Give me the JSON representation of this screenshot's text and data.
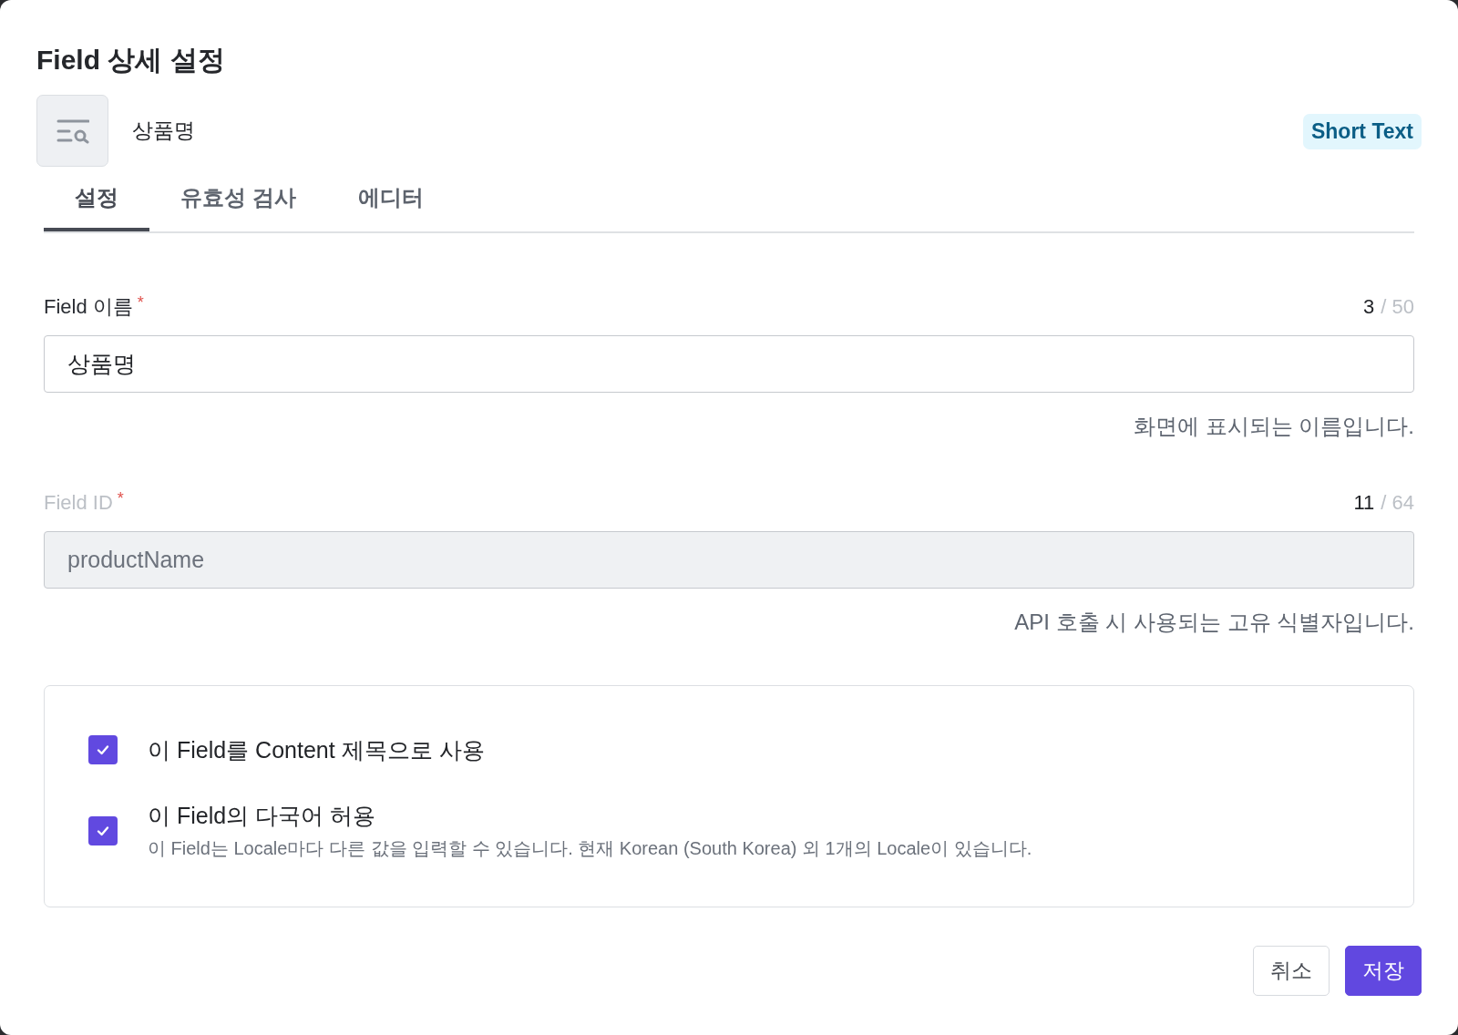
{
  "dialog": {
    "title": "Field 상세 설정"
  },
  "field_header": {
    "name": "상품명",
    "type_badge": "Short Text"
  },
  "tabs": [
    {
      "label": "설정",
      "selected": true
    },
    {
      "label": "유효성 검사",
      "selected": false
    },
    {
      "label": "에디터",
      "selected": false
    }
  ],
  "fields": [
    {
      "label": "Field 이름",
      "required_mark": "*",
      "count": "3",
      "limit": "/ 50",
      "value": "상품명",
      "help": "화면에 표시되는 이름입니다.",
      "disabled": false
    },
    {
      "label": "Field ID",
      "required_mark": "*",
      "count": "11",
      "limit": "/ 64",
      "value": "productName",
      "help": "API 호출 시 사용되는 고유 식별자입니다.",
      "disabled": true
    }
  ],
  "options": [
    {
      "label": "이 Field를 Content 제목으로 사용",
      "checked": true
    },
    {
      "label": "이 Field의 다국어 허용",
      "description": "이 Field는 Locale마다 다른 값을 입력할 수 있습니다. 현재 Korean (South Korea) 외 1개의 Locale이 있습니다.",
      "checked": true
    }
  ],
  "buttons": [
    {
      "label": "취소",
      "kind": "secondary"
    },
    {
      "label": "저장",
      "kind": "primary"
    }
  ]
}
